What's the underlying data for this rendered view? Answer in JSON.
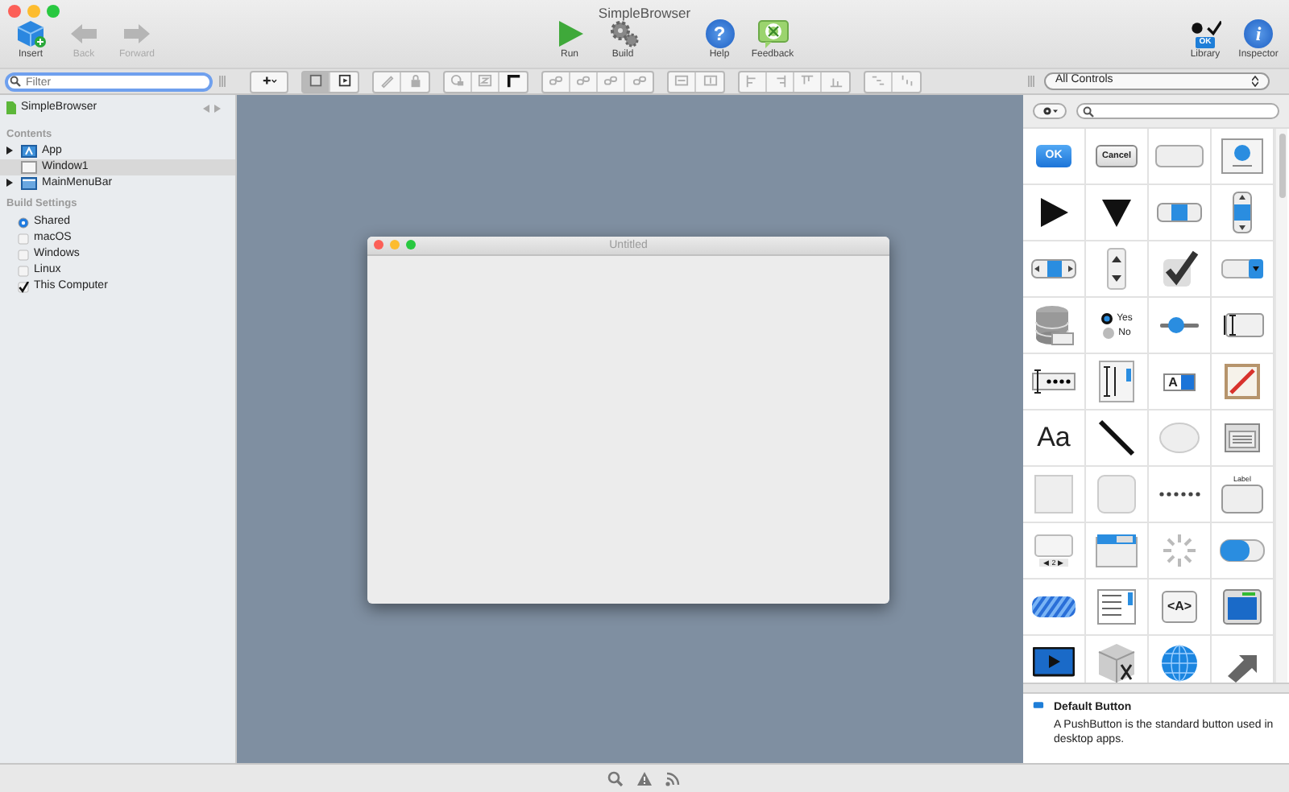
{
  "window": {
    "title": "SimpleBrowser"
  },
  "toolbar": [
    {
      "kind": "insert",
      "label": "Insert",
      "disabled": false
    },
    {
      "kind": "back",
      "label": "Back",
      "disabled": true
    },
    {
      "kind": "forward",
      "label": "Forward",
      "disabled": true
    },
    {
      "kind": "spacer"
    },
    {
      "kind": "run",
      "label": "Run",
      "disabled": false
    },
    {
      "kind": "build",
      "label": "Build",
      "disabled": false
    },
    {
      "kind": "gap"
    },
    {
      "kind": "help",
      "label": "Help",
      "glyph": "?",
      "disabled": false
    },
    {
      "kind": "feedback",
      "label": "Feedback",
      "disabled": false
    },
    {
      "kind": "spacer"
    },
    {
      "kind": "library",
      "label": "Library",
      "glyph": "OK",
      "disabled": false
    },
    {
      "kind": "inspector",
      "label": "Inspector",
      "glyph": "i",
      "disabled": false
    }
  ],
  "filter": {
    "placeholder": "Filter"
  },
  "format_toolbar": [
    [
      {
        "kind": "add",
        "selected": false,
        "disabled": false
      }
    ],
    [
      {
        "kind": "layout",
        "selected": true,
        "disabled": false
      },
      {
        "kind": "preview",
        "selected": false,
        "disabled": false
      }
    ],
    [
      {
        "kind": "edit",
        "selected": false,
        "disabled": true
      },
      {
        "kind": "lock",
        "selected": false,
        "disabled": true
      }
    ],
    [
      {
        "kind": "tab-order",
        "selected": false,
        "disabled": true
      },
      {
        "kind": "z-order",
        "selected": false,
        "disabled": true
      },
      {
        "kind": "corner",
        "selected": false,
        "disabled": false
      }
    ],
    [
      {
        "kind": "link",
        "selected": false,
        "disabled": true
      },
      {
        "kind": "link",
        "selected": false,
        "disabled": true
      },
      {
        "kind": "link",
        "selected": false,
        "disabled": true
      },
      {
        "kind": "link",
        "selected": false,
        "disabled": true
      }
    ],
    [
      {
        "kind": "space-h",
        "selected": false,
        "disabled": true
      },
      {
        "kind": "space-v",
        "selected": false,
        "disabled": true
      }
    ],
    [
      {
        "kind": "align-left",
        "selected": false,
        "disabled": true
      },
      {
        "kind": "align-right",
        "selected": false,
        "disabled": true
      },
      {
        "kind": "align-top",
        "selected": false,
        "disabled": true
      },
      {
        "kind": "align-bottom",
        "selected": false,
        "disabled": true
      }
    ],
    [
      {
        "kind": "dist-h",
        "selected": false,
        "disabled": true
      },
      {
        "kind": "dist-v",
        "selected": false,
        "disabled": true
      }
    ]
  ],
  "sidebar": {
    "project": "SimpleBrowser",
    "contents_heading": "Contents",
    "items": [
      {
        "label": "App",
        "kind": "app",
        "expandable": true,
        "selected": false
      },
      {
        "label": "Window1",
        "kind": "window",
        "expandable": false,
        "selected": true
      },
      {
        "label": "MainMenuBar",
        "kind": "menubar",
        "expandable": true,
        "selected": false
      }
    ],
    "build_heading": "Build Settings",
    "build_items": [
      {
        "label": "Shared",
        "kind": "radio",
        "checked": true
      },
      {
        "label": "macOS",
        "kind": "checkbox",
        "checked": false
      },
      {
        "label": "Windows",
        "kind": "checkbox",
        "checked": false
      },
      {
        "label": "Linux",
        "kind": "checkbox",
        "checked": false
      },
      {
        "label": "This Computer",
        "kind": "checkbox",
        "checked": true
      }
    ]
  },
  "canvas": {
    "window_title": "Untitled"
  },
  "library": {
    "filter": "All Controls",
    "items": [
      {
        "kind": "ok",
        "text": "OK"
      },
      {
        "kind": "cancel",
        "text": "Cancel"
      },
      {
        "kind": "plain"
      },
      {
        "kind": "image-well"
      },
      {
        "kind": "tri-right"
      },
      {
        "kind": "tri-down"
      },
      {
        "kind": "segment"
      },
      {
        "kind": "scroll-v"
      },
      {
        "kind": "scroll-h"
      },
      {
        "kind": "stepper"
      },
      {
        "kind": "check"
      },
      {
        "kind": "popup"
      },
      {
        "kind": "database"
      },
      {
        "kind": "radio",
        "options": [
          {
            "label": "Yes",
            "selected": true
          },
          {
            "label": "No",
            "selected": false
          }
        ]
      },
      {
        "kind": "slider"
      },
      {
        "kind": "textfield"
      },
      {
        "kind": "masked"
      },
      {
        "kind": "textarea"
      },
      {
        "kind": "font-popup",
        "text": "A"
      },
      {
        "kind": "canvas"
      },
      {
        "kind": "label",
        "text": "Aa"
      },
      {
        "kind": "line"
      },
      {
        "kind": "oval"
      },
      {
        "kind": "html"
      },
      {
        "kind": "rect"
      },
      {
        "kind": "rounded"
      },
      {
        "kind": "separator"
      },
      {
        "kind": "groupbox",
        "text": "Label"
      },
      {
        "kind": "pages",
        "text": "◀ 2 ▶"
      },
      {
        "kind": "tabs"
      },
      {
        "kind": "spinner"
      },
      {
        "kind": "toggle"
      },
      {
        "kind": "progress"
      },
      {
        "kind": "listbox"
      },
      {
        "kind": "xml",
        "text": "<A>"
      },
      {
        "kind": "window"
      },
      {
        "kind": "movie"
      },
      {
        "kind": "cube"
      },
      {
        "kind": "globe"
      },
      {
        "kind": "share"
      }
    ],
    "description": {
      "title": "Default Button",
      "text": "A PushButton is the standard button used in desktop apps."
    }
  },
  "status_bar": [
    {
      "kind": "search"
    },
    {
      "kind": "warning"
    },
    {
      "kind": "feed"
    }
  ]
}
